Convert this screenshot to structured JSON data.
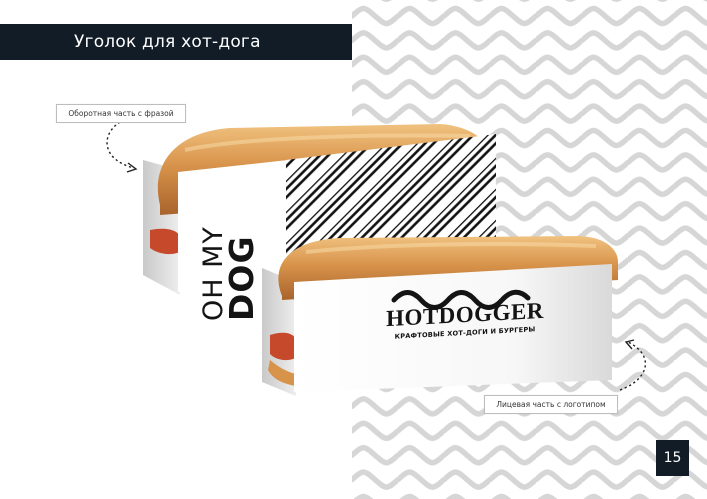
{
  "title": "Уголок для хот-дога",
  "callouts": {
    "back": "Оборотная часть с фразой",
    "front": "Лицевая часть с логотипом"
  },
  "back_holder": {
    "phrase_line1": "OH MY",
    "phrase_line2": "DOG"
  },
  "front_holder": {
    "brand": "HOTDOGGER",
    "tagline": "КРАФТОВЫЕ ХОТ-ДОГИ И БУРГЕРЫ"
  },
  "page_number": "15",
  "colors": {
    "dark": "#121c27",
    "wave": "#d6d6d6",
    "bun": "#d89a55",
    "sausage": "#b2542e"
  }
}
